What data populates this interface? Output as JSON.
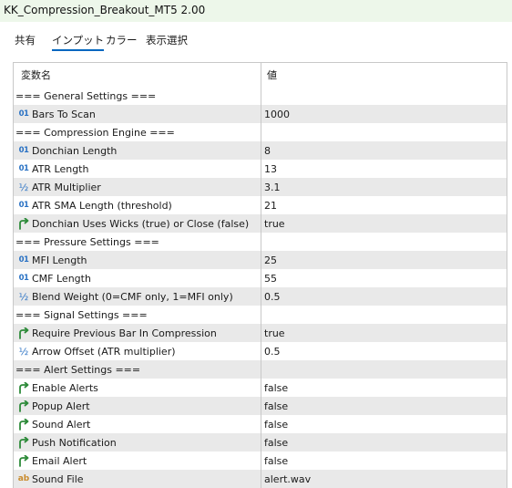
{
  "window": {
    "title": "KK_Compression_Breakout_MT5 2.00"
  },
  "tabs": [
    {
      "label": "共有"
    },
    {
      "label": "インプット"
    },
    {
      "label": "カラー"
    },
    {
      "label": "表示選択"
    }
  ],
  "table": {
    "headers": {
      "name": "変数名",
      "value": "値"
    },
    "rows": [
      {
        "type": "section",
        "label": "=== General Settings ===",
        "value": ""
      },
      {
        "type": "param",
        "icon": "int",
        "label": "Bars To Scan",
        "value": "1000"
      },
      {
        "type": "section",
        "label": "=== Compression Engine ===",
        "value": ""
      },
      {
        "type": "param",
        "icon": "int",
        "label": "Donchian Length",
        "value": "8"
      },
      {
        "type": "param",
        "icon": "int",
        "label": "ATR Length",
        "value": "13"
      },
      {
        "type": "param",
        "icon": "double",
        "label": "ATR Multiplier",
        "value": "3.1"
      },
      {
        "type": "param",
        "icon": "int",
        "label": "ATR SMA Length (threshold)",
        "value": "21"
      },
      {
        "type": "param",
        "icon": "bool",
        "label": "Donchian Uses Wicks (true) or Close (false)",
        "value": "true"
      },
      {
        "type": "section",
        "label": "=== Pressure Settings ===",
        "value": ""
      },
      {
        "type": "param",
        "icon": "int",
        "label": "MFI Length",
        "value": "25"
      },
      {
        "type": "param",
        "icon": "int",
        "label": "CMF Length",
        "value": "55"
      },
      {
        "type": "param",
        "icon": "double",
        "label": "Blend Weight (0=CMF only, 1=MFI only)",
        "value": "0.5"
      },
      {
        "type": "section",
        "label": "=== Signal Settings ===",
        "value": ""
      },
      {
        "type": "param",
        "icon": "bool",
        "label": "Require Previous Bar In Compression",
        "value": "true"
      },
      {
        "type": "param",
        "icon": "double",
        "label": "Arrow Offset (ATR multiplier)",
        "value": "0.5"
      },
      {
        "type": "section",
        "label": "=== Alert Settings ===",
        "value": ""
      },
      {
        "type": "param",
        "icon": "bool",
        "label": "Enable Alerts",
        "value": "false"
      },
      {
        "type": "param",
        "icon": "bool",
        "label": "Popup Alert",
        "value": "false"
      },
      {
        "type": "param",
        "icon": "bool",
        "label": "Sound Alert",
        "value": "false"
      },
      {
        "type": "param",
        "icon": "bool",
        "label": "Push Notification",
        "value": "false"
      },
      {
        "type": "param",
        "icon": "bool",
        "label": "Email Alert",
        "value": "false"
      },
      {
        "type": "param",
        "icon": "string",
        "label": "Sound File",
        "value": "alert.wav"
      }
    ]
  },
  "icons": {
    "int": {
      "glyph": "01",
      "name": "integer-type-icon"
    },
    "double": {
      "glyph": "½",
      "name": "double-type-icon"
    },
    "bool": {
      "glyph": "",
      "name": "boolean-type-icon"
    },
    "string": {
      "glyph": "ab",
      "name": "string-type-icon"
    }
  },
  "colors": {
    "title_bg": "#edf7ea",
    "accent": "#0067c0",
    "row_shade": "#e9e9e9",
    "icon_blue": "#2a72c4",
    "icon_green": "#2e8b3a",
    "icon_orange": "#c98b2d"
  }
}
